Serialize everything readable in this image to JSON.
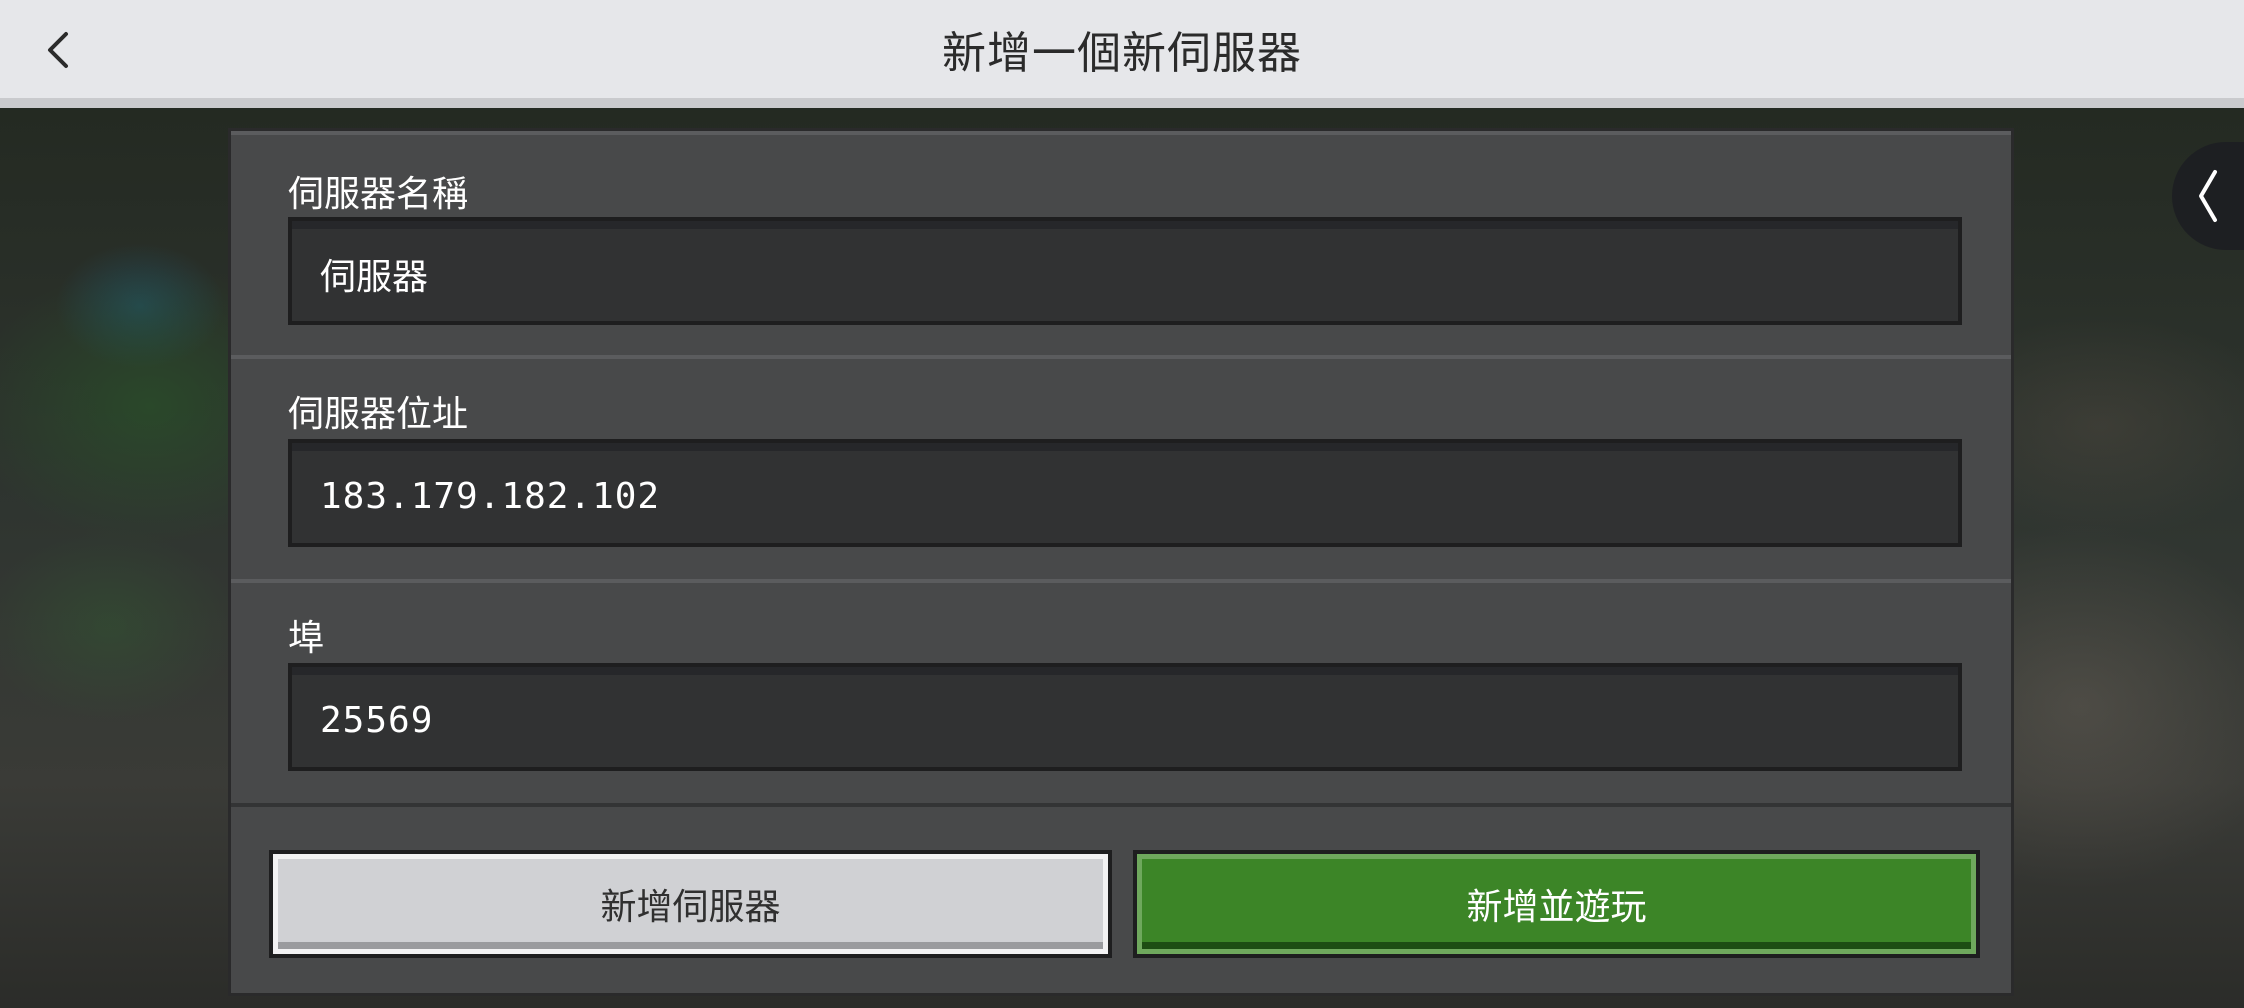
{
  "header": {
    "title": "新增一個新伺服器",
    "back_icon": "chevron-left-icon"
  },
  "side_tab": {
    "icon": "chevron-left-icon"
  },
  "form": {
    "server_name": {
      "label": "伺服器名稱",
      "value": "伺服器"
    },
    "server_address": {
      "label": "伺服器位址",
      "value": "183.179.182.102"
    },
    "port": {
      "label": "埠",
      "value": "25569"
    }
  },
  "buttons": {
    "add_server": "新增伺服器",
    "add_and_play": "新增並遊玩"
  },
  "colors": {
    "topbar": "#e6e7ea",
    "panel": "#48494a",
    "input": "#313233",
    "primary_button": "#3c8527",
    "secondary_button": "#d0d1d4"
  }
}
